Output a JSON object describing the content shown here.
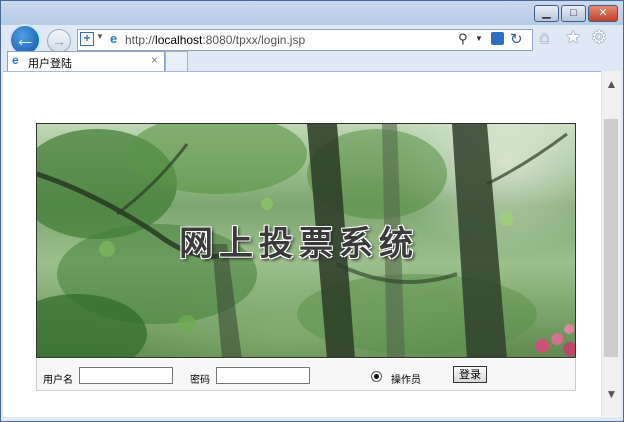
{
  "browser": {
    "address": {
      "url_prefix": "http://",
      "url_host": "localhost",
      "url_rest": ":8080/tpxx/login.jsp"
    },
    "tab": {
      "title": "用户登陆",
      "close_glyph": "×"
    },
    "window_controls": {
      "minimize": "▁",
      "maximize": "□",
      "close": "✕"
    }
  },
  "page": {
    "banner_title": "网上投票系统",
    "login": {
      "username_label": "用户名",
      "password_label": "密码",
      "username_value": "",
      "password_value": "",
      "role_label": "操作员",
      "role_selected": true,
      "submit_label": "登录"
    }
  },
  "icons": [
    "back-arrow-icon",
    "forward-arrow-icon",
    "add-site-icon",
    "ie-logo-icon",
    "search-icon",
    "compat-view-icon",
    "refresh-icon",
    "home-icon",
    "favorites-star-icon",
    "settings-gear-icon"
  ],
  "colors": {
    "back_button": "#1b6cc8",
    "close_button": "#c2402c",
    "chrome_bg": "#dfe9f5"
  }
}
